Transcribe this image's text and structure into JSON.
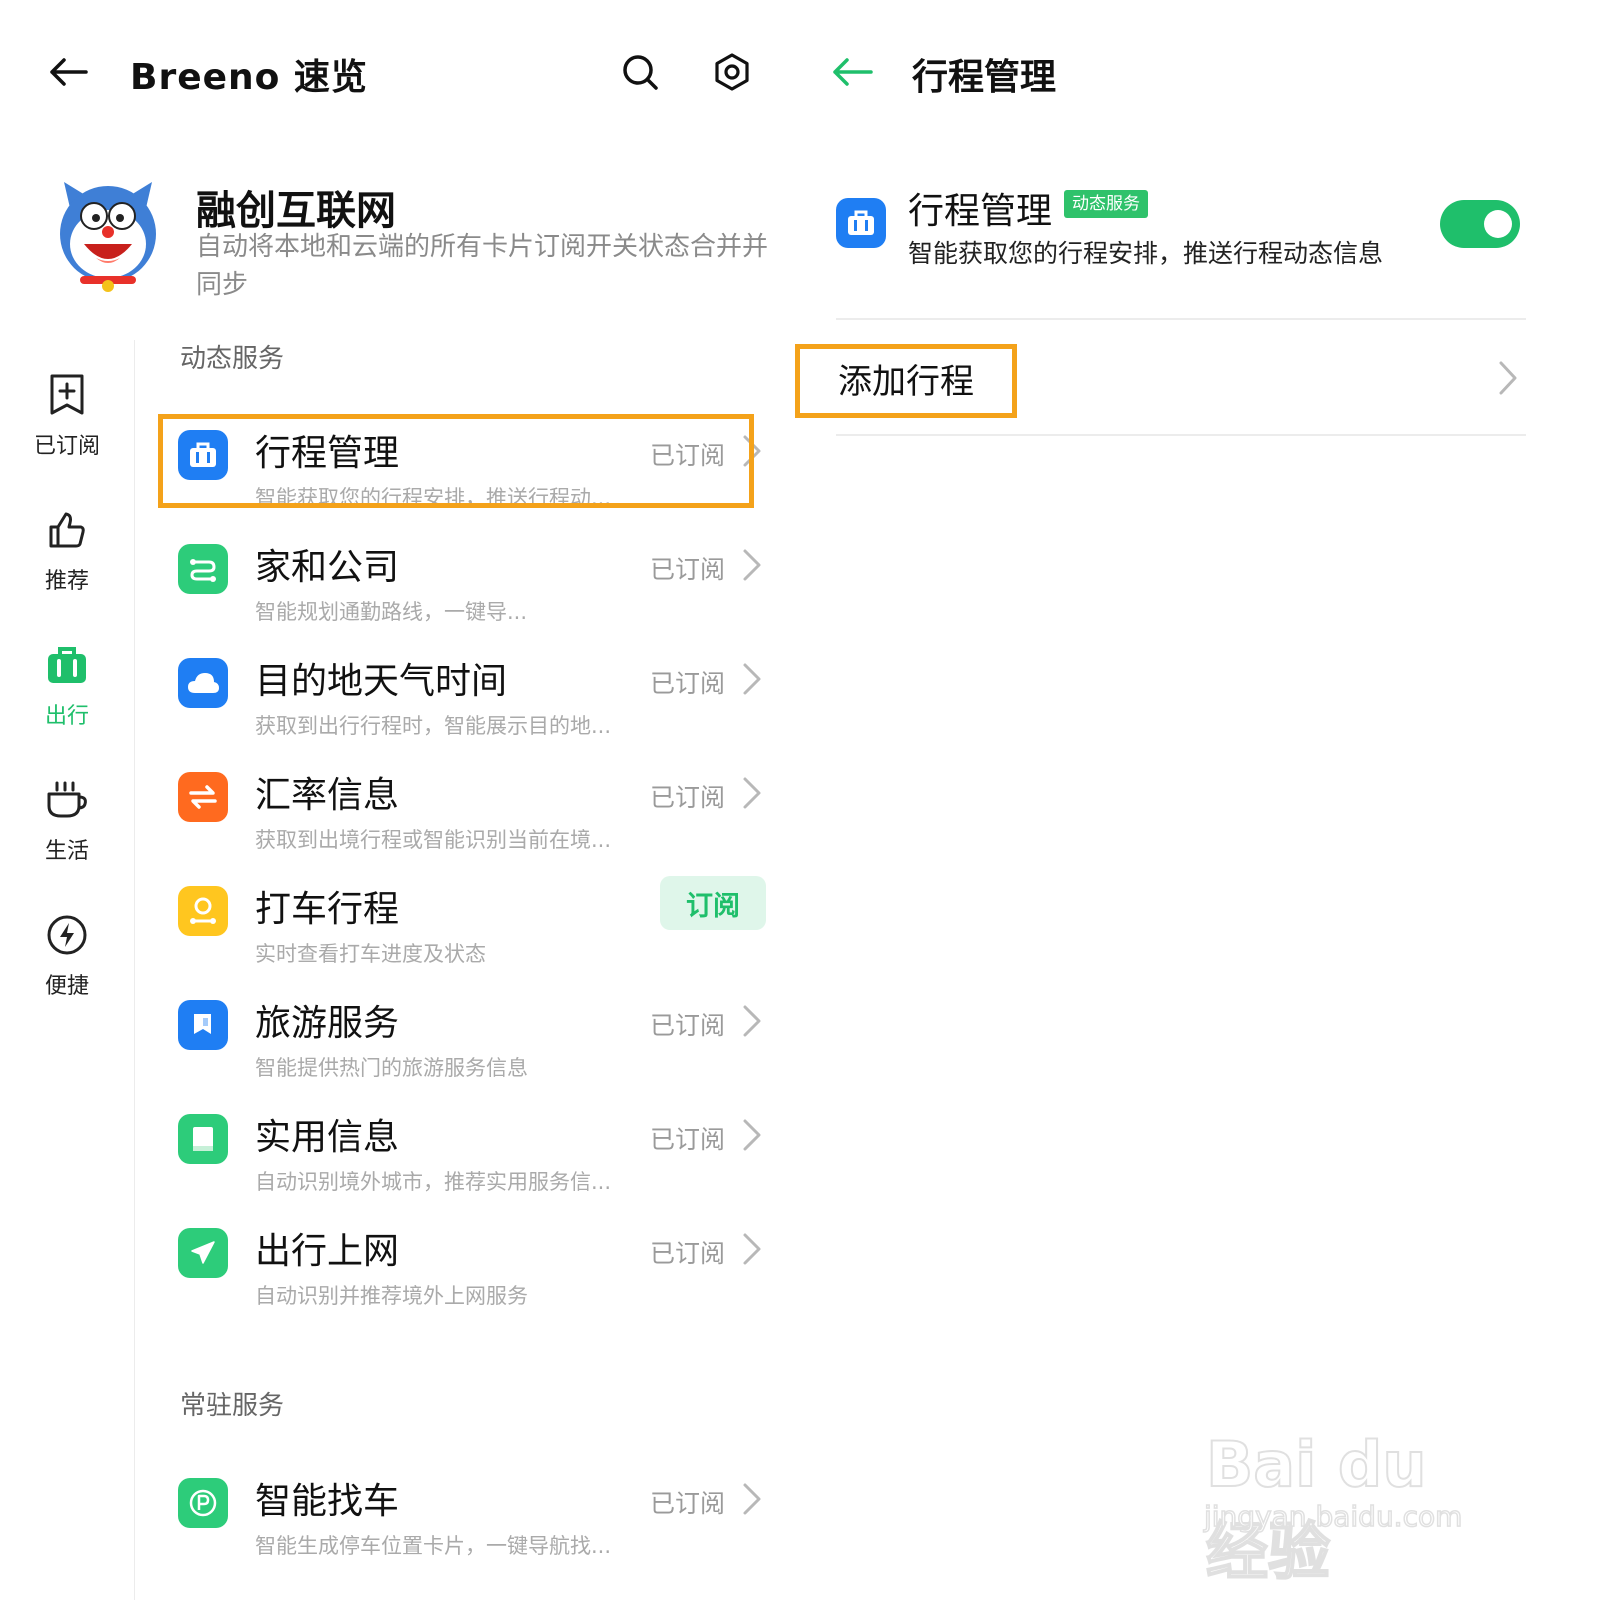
{
  "left": {
    "header": {
      "title": "Breeno 速览",
      "back_icon": "arrow-left-icon",
      "search_icon": "search-icon",
      "settings_icon": "hexagon-settings-icon"
    },
    "profile": {
      "name": "融创互联网",
      "description": "自动将本地和云端的所有卡片订阅开关状态合并并同步",
      "avatar_icon": "cartoon-cat-avatar"
    },
    "sidebar": {
      "items": [
        {
          "label": "已订阅",
          "icon": "bookmark-plus-icon"
        },
        {
          "label": "推荐",
          "icon": "thumbs-up-icon"
        },
        {
          "label": "出行",
          "icon": "suitcase-icon",
          "active": true
        },
        {
          "label": "生活",
          "icon": "coffee-cup-icon"
        },
        {
          "label": "便捷",
          "icon": "lightning-icon"
        }
      ],
      "active_color": "#1fbf6b"
    },
    "sections": [
      {
        "title": "动态服务",
        "items": [
          {
            "title": "行程管理",
            "desc": "智能获取您的行程安排，推送行程动...",
            "status": "已订阅",
            "icon": "suitcase-icon",
            "color": "#1f7ef3"
          },
          {
            "title": "家和公司",
            "desc": "智能规划通勤路线，一键导...",
            "status": "已订阅",
            "icon": "route-icon",
            "color": "#2dcc7a"
          },
          {
            "title": "目的地天气时间",
            "desc": "获取到出行行程时，智能展示目的地...",
            "status": "已订阅",
            "icon": "cloud-icon",
            "color": "#1f7ef3"
          },
          {
            "title": "汇率信息",
            "desc": "获取到出境行程或智能识别当前在境...",
            "status": "已订阅",
            "icon": "exchange-icon",
            "color": "#ff6a1f"
          },
          {
            "title": "打车行程",
            "desc": "实时查看打车进度及状态",
            "status": "订阅",
            "icon": "location-pin-icon",
            "color": "#ffc61f"
          },
          {
            "title": "旅游服务",
            "desc": "智能提供热门的旅游服务信息",
            "status": "已订阅",
            "icon": "flag-icon",
            "color": "#1f7ef3"
          },
          {
            "title": "实用信息",
            "desc": "自动识别境外城市，推荐实用服务信...",
            "status": "已订阅",
            "icon": "book-icon",
            "color": "#2dcc7a"
          },
          {
            "title": "出行上网",
            "desc": "自动识别并推荐境外上网服务",
            "status": "已订阅",
            "icon": "airplane-icon",
            "color": "#2dcc7a"
          }
        ]
      },
      {
        "title": "常驻服务",
        "items": [
          {
            "title": "智能找车",
            "desc": "智能生成停车位置卡片，一键导航找...",
            "status": "已订阅",
            "icon": "parking-icon",
            "color": "#2dcc7a"
          }
        ]
      }
    ],
    "highlight_color": "#f4a21a"
  },
  "right": {
    "header": {
      "title": "行程管理",
      "back_icon": "arrow-left-icon",
      "back_color": "#1fbf6b"
    },
    "detail": {
      "title": "行程管理",
      "badge": "动态服务",
      "desc": "智能获取您的行程安排，推送行程动态信息",
      "icon": "suitcase-icon",
      "toggle_on": true
    },
    "add_row": {
      "label": "添加行程",
      "icon": "chevron-right-icon"
    }
  },
  "watermark": {
    "line1": "Bai du 经验",
    "line2": "jingyan.baidu.com"
  }
}
